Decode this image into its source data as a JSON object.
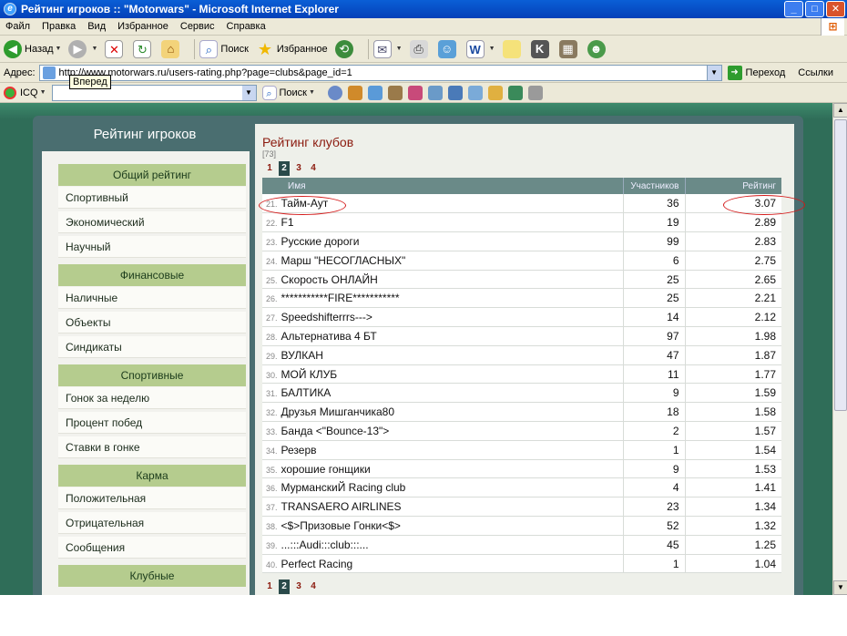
{
  "window": {
    "title": "Рейтинг игроков :: \"Motorwars\" - Microsoft Internet Explorer"
  },
  "menu": [
    "Файл",
    "Правка",
    "Вид",
    "Избранное",
    "Сервис",
    "Справка"
  ],
  "toolbar": {
    "back_label": "Назад",
    "search_label": "Поиск",
    "favorites_label": "Избранное"
  },
  "address": {
    "label": "Адрес:",
    "url": "http://www.motorwars.ru/users-rating.php?page=clubs&page_id=1",
    "go_label": "Переход",
    "links_label": "Ссылки"
  },
  "tooltip": "Вперед",
  "icq": {
    "label": "ICQ",
    "search_label": "Поиск"
  },
  "sidebar": {
    "title": "Рейтинг игроков",
    "sections": [
      {
        "title": "Общий рейтинг",
        "items": [
          "Спортивный",
          "Экономический",
          "Научный"
        ]
      },
      {
        "title": "Финансовые",
        "items": [
          "Наличные",
          "Объекты",
          "Синдикаты"
        ]
      },
      {
        "title": "Спортивные",
        "items": [
          "Гонок за неделю",
          "Процент побед",
          "Ставки в гонке"
        ]
      },
      {
        "title": "Карма",
        "items": [
          "Положительная",
          "Отрицательная",
          "Сообщения"
        ]
      },
      {
        "title": "Клубные",
        "items": []
      }
    ]
  },
  "main": {
    "title": "Рейтинг клубов",
    "count": "[73]",
    "pages": [
      "1",
      "2",
      "3",
      "4"
    ],
    "current_page": "2",
    "columns": {
      "name": "Имя",
      "members": "Участников",
      "rating": "Рейтинг"
    },
    "rows": [
      {
        "rank": "21.",
        "name": "Тайм-Аут",
        "members": "36",
        "rating": "3.07"
      },
      {
        "rank": "22.",
        "name": "F1",
        "members": "19",
        "rating": "2.89"
      },
      {
        "rank": "23.",
        "name": "Русские дороги",
        "members": "99",
        "rating": "2.83"
      },
      {
        "rank": "24.",
        "name": "Марш \"НЕСОГЛАСНЫХ\"",
        "members": "6",
        "rating": "2.75"
      },
      {
        "rank": "25.",
        "name": "Скорость ОНЛАЙН",
        "members": "25",
        "rating": "2.65"
      },
      {
        "rank": "26.",
        "name": "***********FIRE***********",
        "members": "25",
        "rating": "2.21"
      },
      {
        "rank": "27.",
        "name": "Speedshifterrrs--->",
        "members": "14",
        "rating": "2.12"
      },
      {
        "rank": "28.",
        "name": "Альтернатива 4 БТ",
        "members": "97",
        "rating": "1.98"
      },
      {
        "rank": "29.",
        "name": "ВУЛКАН",
        "members": "47",
        "rating": "1.87"
      },
      {
        "rank": "30.",
        "name": "МОЙ КЛУБ",
        "members": "11",
        "rating": "1.77"
      },
      {
        "rank": "31.",
        "name": "БАЛТИКА",
        "members": "9",
        "rating": "1.59"
      },
      {
        "rank": "32.",
        "name": "Друзья Мишганчика80",
        "members": "18",
        "rating": "1.58"
      },
      {
        "rank": "33.",
        "name": "Банда <\"Bounce-13\">",
        "members": "2",
        "rating": "1.57"
      },
      {
        "rank": "34.",
        "name": "Резерв",
        "members": "1",
        "rating": "1.54"
      },
      {
        "rank": "35.",
        "name": "хорошие гонщики",
        "members": "9",
        "rating": "1.53"
      },
      {
        "rank": "36.",
        "name": "МурманскиЙ Racing club",
        "members": "4",
        "rating": "1.41"
      },
      {
        "rank": "37.",
        "name": "TRANSAERO AIRLINES",
        "members": "23",
        "rating": "1.34"
      },
      {
        "rank": "38.",
        "name": "<$>Призовые Гонки<$>",
        "members": "52",
        "rating": "1.32"
      },
      {
        "rank": "39.",
        "name": "...:::Audi:::club:::...",
        "members": "45",
        "rating": "1.25"
      },
      {
        "rank": "40.",
        "name": "Perfect Racing",
        "members": "1",
        "rating": "1.04"
      }
    ]
  },
  "colors": {
    "accent": "#8b1a0e",
    "category_bg": "#b5cc8e",
    "highlight": "#d41a1a"
  }
}
